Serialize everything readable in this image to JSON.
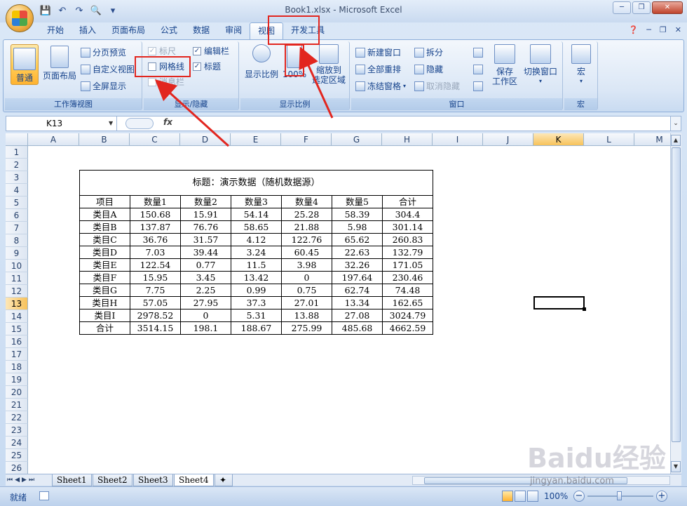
{
  "window": {
    "title": "Book1.xlsx - Microsoft Excel"
  },
  "qat": [
    "save-icon",
    "undo-icon",
    "redo-icon",
    "print-preview-icon",
    "customize-icon"
  ],
  "tabs": [
    "开始",
    "插入",
    "页面布局",
    "公式",
    "数据",
    "审阅",
    "视图",
    "开发工具"
  ],
  "active_tab": "视图",
  "ribbon": {
    "groups": {
      "workbook_views": "工作簿视图",
      "show_hide": "显示/隐藏",
      "zoom": "显示比例",
      "window": "窗口",
      "macros": "宏"
    },
    "workbook_views": {
      "normal": "普通",
      "page_layout": "页面布局",
      "page_break": "分页预览",
      "custom_views": "自定义视图",
      "full_screen": "全屏显示"
    },
    "show_hide": {
      "ruler": {
        "label": "标尺",
        "checked": true,
        "enabled": false
      },
      "gridlines": {
        "label": "网格线",
        "checked": false,
        "enabled": true
      },
      "message_bar": {
        "label": "消息栏",
        "checked": false,
        "enabled": false
      },
      "formula_bar": {
        "label": "编辑栏",
        "checked": true,
        "enabled": true
      },
      "headings": {
        "label": "标题",
        "checked": true,
        "enabled": true
      }
    },
    "zoom": {
      "zoom": "显示比例",
      "hundred": "100%",
      "zoom_to_selection_1": "缩放到",
      "zoom_to_selection_2": "选定区域"
    },
    "window": {
      "new_window": "新建窗口",
      "arrange_all": "全部重排",
      "freeze_panes": "冻结窗格",
      "split": "拆分",
      "hide": "隐藏",
      "unhide": "取消隐藏",
      "save_workspace_1": "保存",
      "save_workspace_2": "工作区",
      "switch_windows": "切换窗口"
    },
    "macros": {
      "macros": "宏"
    }
  },
  "formula_bar": {
    "name_box": "K13",
    "fx": "fx",
    "value": ""
  },
  "columns": [
    "A",
    "B",
    "C",
    "D",
    "E",
    "F",
    "G",
    "H",
    "I",
    "J",
    "K",
    "L",
    "M"
  ],
  "selected_column": "K",
  "rows": [
    "1",
    "2",
    "3",
    "4",
    "5",
    "6",
    "7",
    "8",
    "9",
    "10",
    "11",
    "12",
    "13",
    "14",
    "15",
    "16",
    "17",
    "18",
    "19",
    "20",
    "21",
    "22",
    "23",
    "24",
    "25",
    "26"
  ],
  "selected_row": "13",
  "table": {
    "title": "标题：演示数据（随机数据源）",
    "headers": [
      "项目",
      "数量1",
      "数量2",
      "数量3",
      "数量4",
      "数量5",
      "合计"
    ],
    "rows": [
      [
        "类目A",
        "150.68",
        "15.91",
        "54.14",
        "25.28",
        "58.39",
        "304.4"
      ],
      [
        "类目B",
        "137.87",
        "76.76",
        "58.65",
        "21.88",
        "5.98",
        "301.14"
      ],
      [
        "类目C",
        "36.76",
        "31.57",
        "4.12",
        "122.76",
        "65.62",
        "260.83"
      ],
      [
        "类目D",
        "7.03",
        "39.44",
        "3.24",
        "60.45",
        "22.63",
        "132.79"
      ],
      [
        "类目E",
        "122.54",
        "0.77",
        "11.5",
        "3.98",
        "32.26",
        "171.05"
      ],
      [
        "类目F",
        "15.95",
        "3.45",
        "13.42",
        "0",
        "197.64",
        "230.46"
      ],
      [
        "类目G",
        "7.75",
        "2.25",
        "0.99",
        "0.75",
        "62.74",
        "74.48"
      ],
      [
        "类目H",
        "57.05",
        "27.95",
        "37.3",
        "27.01",
        "13.34",
        "162.65"
      ],
      [
        "类目I",
        "2978.52",
        "0",
        "5.31",
        "13.88",
        "27.08",
        "3024.79"
      ],
      [
        "合计",
        "3514.15",
        "198.1",
        "188.67",
        "275.99",
        "485.68",
        "4662.59"
      ]
    ]
  },
  "sheets": [
    "Sheet1",
    "Sheet2",
    "Sheet3",
    "Sheet4"
  ],
  "active_sheet": "Sheet4",
  "status": {
    "ready": "就绪",
    "zoom": "100%"
  },
  "watermark": {
    "brand": "Baidu经验",
    "url": "jingyan.baidu.com"
  }
}
